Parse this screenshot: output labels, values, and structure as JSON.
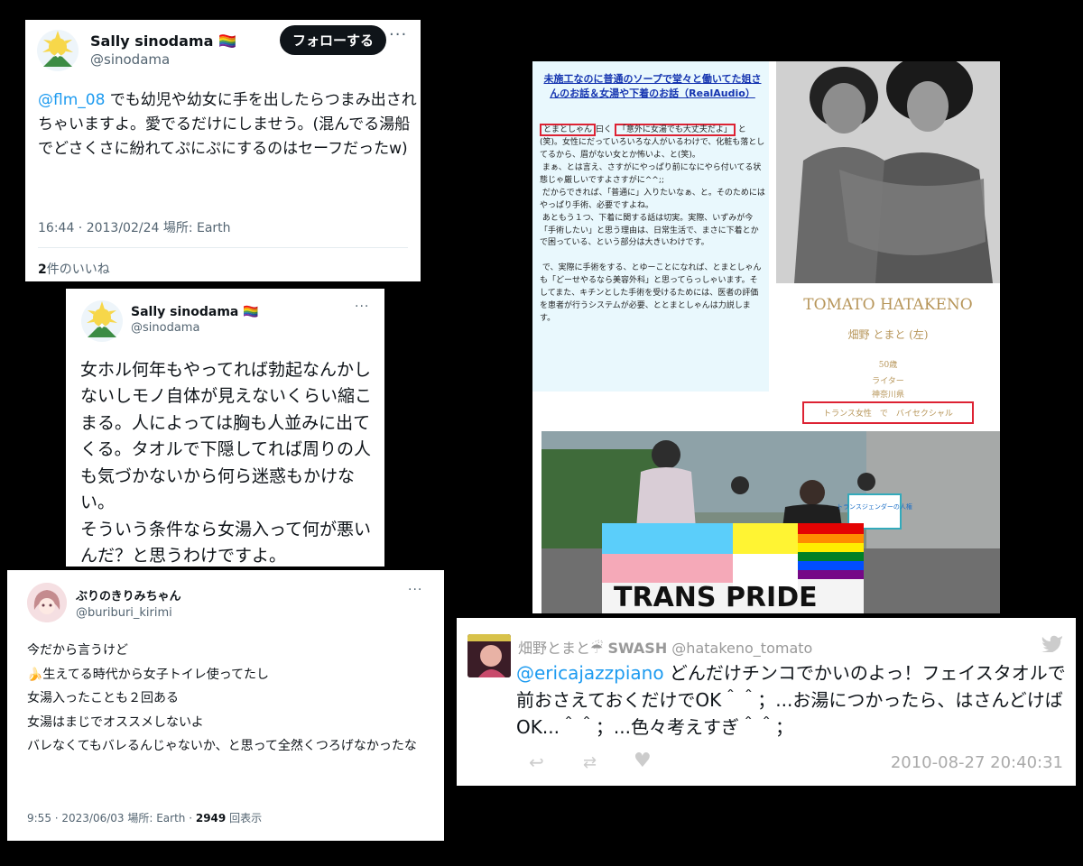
{
  "tweet1": {
    "name": "Sally sinodama 🏳️‍🌈",
    "handle": "@sinodama",
    "follow": "フォローする",
    "mention": "@flm_08",
    "body": " でも幼児や幼女に手を出したらつまみ出されちゃいますよ。愛でるだけにしませう。(混んでる湯船でどさくさに紛れてぷにぷにするのはセーフだったw)",
    "meta": "16:44 · 2013/02/24 場所: Earth",
    "likes_count": "2",
    "likes_label": "件のいいね"
  },
  "tweet2": {
    "name": "Sally sinodama 🏳️‍🌈",
    "handle": "@sinodama",
    "body": "女ホル何年もやってれば勃起なんかしないしモノ自体が見えないくらい縮こまる。人によっては胸も人並みに出てくる。タオルで下隠してれば周りの人も気づかないから何ら迷惑もかけない。\nそういう条件なら女湯入って何が悪いんだ？と思うわけですよ。"
  },
  "tweet3": {
    "name": "ぶりのきりみちゃん",
    "handle": "@buriburi_kirimi",
    "lines": [
      "今だから言うけど",
      "🍌生えてる時代から女子トイレ使ってたし",
      "女湯入ったことも２回ある",
      "女湯はまじでオススメしないよ",
      "バレなくてもバレるんじゃないか、と思って全然くつろげなかったな"
    ],
    "meta": "9:55 · 2023/06/03 場所: Earth · ",
    "views_count": "2949",
    "views_label": "回表示"
  },
  "article": {
    "title": "未施工なのに普通のソープで堂々と働いてた姐さんのお話＆女湯や下着のお話（RealAudio）",
    "hl1": "とまとしゃん",
    "hl1_suffix": "曰く",
    "hl2": "「意外に女湯でも大丈夫だよ」",
    "para1": "と(笑)。女性にだっていろいろな人がいるわけで、化粧も落としてるから、眉がない女とか怖いよ、と(笑)。",
    "para2": "まぁ、とは言え、さすがにやっぱり前になにやら付いてる状態じゃ厳しいですよさすがに^^;;",
    "para3": "だからできれば、「普通に」入りたいなぁ、と。そのためにはやっぱり手術、必要ですよね。",
    "para4": "あともう１つ、下着に関する話は切実。実際、いずみが今「手術したい」と思う理由は、日常生活で、まさに下着とかで困っている、という部分は大きいわけです。",
    "para5": "で、実際に手術をする、とゆーことになれば、とまとしゃんも「どーせやるなら美容外科」と思ってらっしゃいます。そしてまた、キチンとした手術を受けるためには、医者の評価を患者が行うシステムが必要、ととまとしゃんは力説します。",
    "profile_name_en": "TOMATO HATAKENO",
    "profile_name_jp": "畑野 とまと (左)",
    "profile_age": "50歳",
    "profile_job": "ライター",
    "profile_place": "神奈川県",
    "profile_identity": "トランス女性　で　バイセクシャル",
    "sign_text": "トランスジェンダーの人権",
    "banner_text": "TRANS PRIDE"
  },
  "tweet5": {
    "name": "畑野とまと",
    "service": "SWASH",
    "handle": "@hatakeno_tomato",
    "mention": "@ericajazzpiano",
    "body": " どんだけチンコでかいのよっ！フェイスタオルで前おさえておくだけでOK＾＾；...お湯につかったら、はさんどけばOK...＾＾；...色々考えすぎ＾＾；",
    "timestamp": "2010-08-27 20:40:31"
  },
  "icons": [
    "sun-avatar-icon",
    "more-icon",
    "reply-icon",
    "retweet-icon",
    "like-icon",
    "twitter-bird-icon"
  ]
}
